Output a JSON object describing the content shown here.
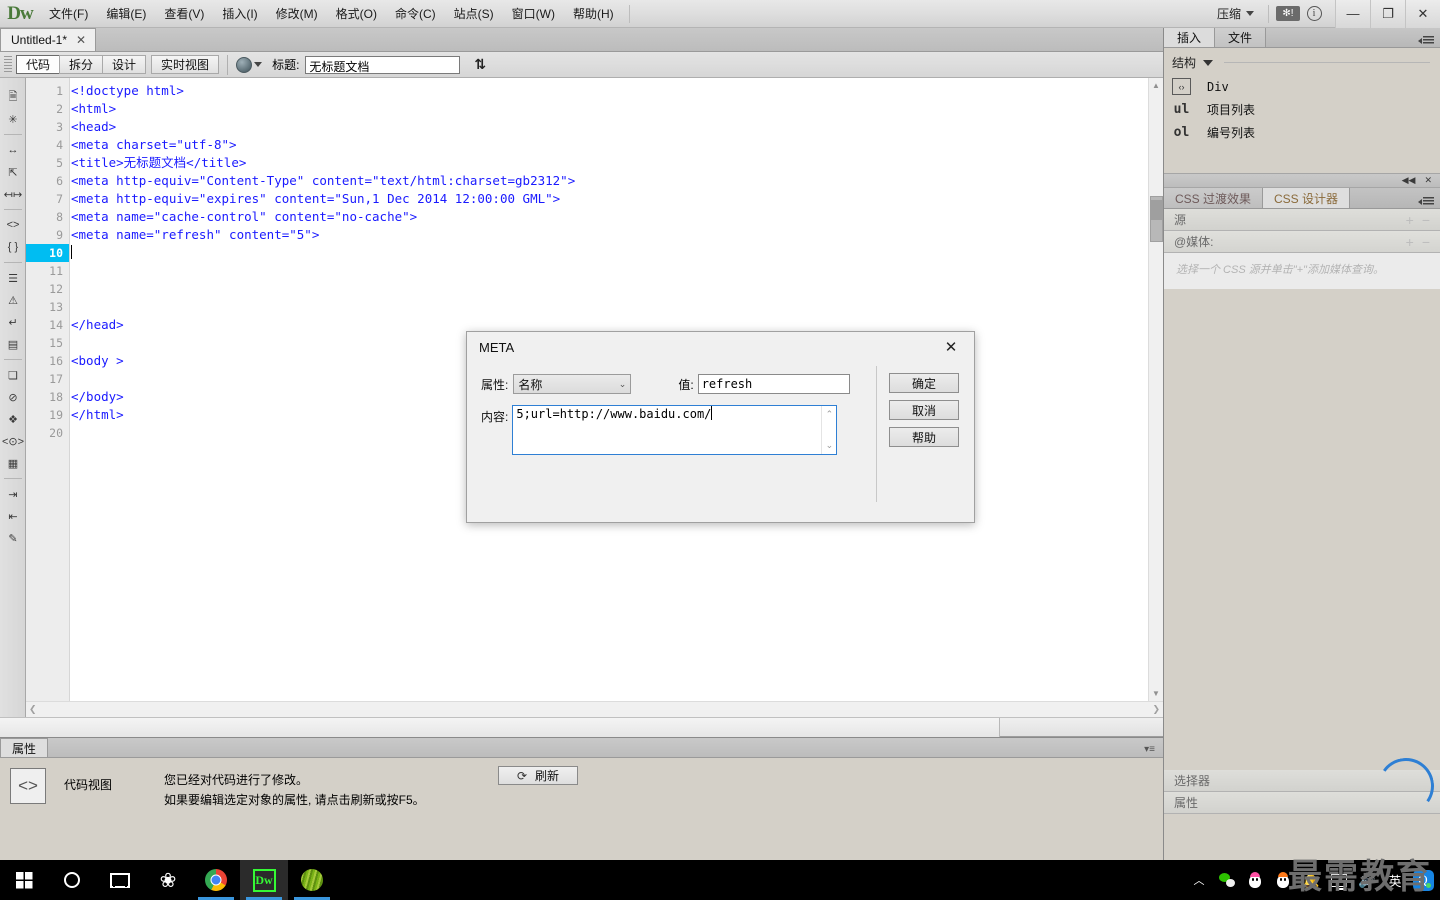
{
  "app": {
    "logo": "Dw",
    "menus": [
      {
        "label": "文件(F)"
      },
      {
        "label": "编辑(E)"
      },
      {
        "label": "查看(V)"
      },
      {
        "label": "插入(I)"
      },
      {
        "label": "修改(M)"
      },
      {
        "label": "格式(O)"
      },
      {
        "label": "命令(C)"
      },
      {
        "label": "站点(S)"
      },
      {
        "label": "窗口(W)"
      },
      {
        "label": "帮助(H)"
      }
    ],
    "workspace_label": "压缩",
    "win_minimize": "—",
    "win_restore": "❐",
    "win_close": "✕"
  },
  "doctab": {
    "name": "Untitled-1*",
    "close": "✕"
  },
  "viewbar": {
    "code": "代码",
    "split": "拆分",
    "design": "设计",
    "live": "实时视图",
    "title_label": "标题:",
    "title_value": "无标题文档"
  },
  "editor": {
    "lines": [
      {
        "n": "1",
        "code": "<!doctype html>"
      },
      {
        "n": "2",
        "code": "<html>"
      },
      {
        "n": "3",
        "code": "<head>"
      },
      {
        "n": "4",
        "code": "<meta charset=\"utf-8\">"
      },
      {
        "n": "5",
        "code": "<title>无标题文档</title>"
      },
      {
        "n": "6",
        "code": "<meta http-equiv=\"Content-Type\" content=\"text/html:charset=gb2312\">"
      },
      {
        "n": "7",
        "code": "<meta http-equiv=\"expires\" content=\"Sun,1 Dec 2014 12:00:00 GML\">"
      },
      {
        "n": "8",
        "code": "<meta name=\"cache-control\" content=\"no-cache\">"
      },
      {
        "n": "9",
        "code": "<meta name=\"refresh\" content=\"5\">"
      },
      {
        "n": "10",
        "code": "",
        "current": true
      },
      {
        "n": "11",
        "code": ""
      },
      {
        "n": "12",
        "code": ""
      },
      {
        "n": "13",
        "code": ""
      },
      {
        "n": "14",
        "code": "</head>"
      },
      {
        "n": "15",
        "code": ""
      },
      {
        "n": "16",
        "code": "<body >"
      },
      {
        "n": "17",
        "code": ""
      },
      {
        "n": "18",
        "code": "</body>"
      },
      {
        "n": "19",
        "code": "</html>"
      },
      {
        "n": "20",
        "code": ""
      }
    ],
    "cursor_line": "10"
  },
  "dialog": {
    "title": "META",
    "close": "✕",
    "attribute_label": "属性:",
    "attribute_value": "名称",
    "value_label": "值:",
    "value_value": "refresh",
    "content_label": "内容:",
    "content_value": "5;url=http://www.baidu.com/",
    "ok": "确定",
    "cancel": "取消",
    "help": "帮助"
  },
  "properties": {
    "tab": "属性",
    "view_name": "代码视图",
    "message_line1": "您已经对代码进行了修改。",
    "message_line2": "如果要编辑选定对象的属性, 请点击刷新或按F5。",
    "refresh": "刷新"
  },
  "rightdock": {
    "tabs": [
      {
        "label": "插入",
        "active": true
      },
      {
        "label": "文件",
        "active": false
      }
    ],
    "insert": {
      "category": "结构",
      "items": [
        {
          "icon": "code-brackets-icon",
          "glyph": "‹›",
          "label": "Div"
        },
        {
          "icon": "ul-icon",
          "glyph": "ul",
          "label": "项目列表"
        },
        {
          "icon": "ol-icon",
          "glyph": "ol",
          "label": "编号列表"
        }
      ]
    },
    "css": {
      "tabs": [
        {
          "label": "CSS 过渡效果",
          "active": false
        },
        {
          "label": "CSS 设计器",
          "active": true
        }
      ],
      "source_label": "源",
      "media_label": "@媒体:",
      "media_hint": "选择一个 CSS 源并单击\"+\"添加媒体查询。",
      "selector_label": "选择器",
      "properties_label": "属性"
    }
  },
  "watermark": "最需教育",
  "taskbar": {
    "items": [
      {
        "name": "start-button",
        "icon": "windows-logo-icon"
      },
      {
        "name": "cortana-button",
        "icon": "circle-icon"
      },
      {
        "name": "task-view-button",
        "icon": "task-view-icon"
      },
      {
        "name": "app-pinwheel",
        "icon": "pinwheel-icon"
      },
      {
        "name": "chrome-taskbar-item",
        "icon": "chrome-icon"
      },
      {
        "name": "dreamweaver-taskbar-item",
        "icon": "dreamweaver-icon"
      },
      {
        "name": "green-app-taskbar-item",
        "icon": "green-circle-icon"
      }
    ],
    "tray": {
      "chevron": "︿",
      "ime": "英",
      "qq_browser": "Q"
    }
  },
  "colors": {
    "accent_cyan": "#00bdf2",
    "code_blue": "#1a1aff",
    "dialog_focus": "#2e7fd4",
    "taskbar_underline": "#3a96dd"
  }
}
